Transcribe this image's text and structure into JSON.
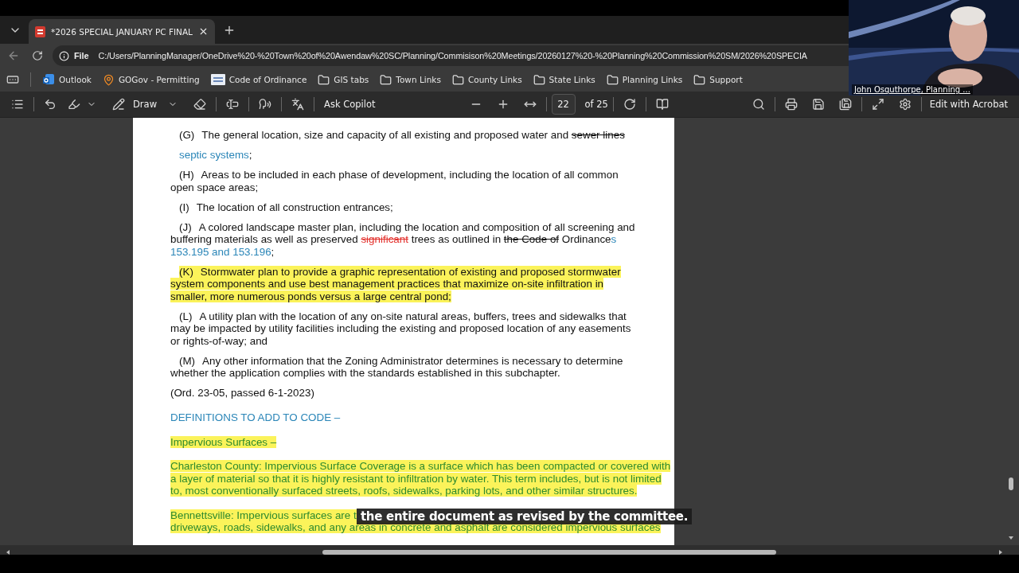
{
  "tabs": [
    {
      "title": "*2026 SPECIAL JANUARY PC FINAL",
      "selected": true
    }
  ],
  "address": {
    "scheme": "File",
    "url": "C:/Users/PlanningManager/OneDrive%20-%20Town%20of%20Awendaw%20SC/Planning/Commisison%20Meetings/20260127%20-%20Planning%20Commission%20SM/2026%20SPECIA"
  },
  "bookmarks": [
    {
      "kind": "outlook",
      "label": "Outlook"
    },
    {
      "kind": "gogov",
      "label": "GOGov - Permitting"
    },
    {
      "kind": "alp",
      "label": "Code of Ordinance"
    },
    {
      "kind": "folder",
      "label": "GIS tabs"
    },
    {
      "kind": "folder",
      "label": "Town Links"
    },
    {
      "kind": "folder",
      "label": "County Links"
    },
    {
      "kind": "folder",
      "label": "State Links"
    },
    {
      "kind": "folder",
      "label": "Planning Links"
    },
    {
      "kind": "folder",
      "label": "Support"
    }
  ],
  "toolbar": {
    "draw_label": "Draw",
    "copilot_label": "Ask Copilot",
    "page": "22",
    "page_total": "of 25",
    "edit_label": "Edit with Acrobat"
  },
  "document": {
    "paragraphs": [
      {
        "kind": "item",
        "label": "(G)",
        "highlighted": false,
        "segments": [
          {
            "kind": "normal",
            "text": "The general location, size and capacity of all existing and proposed water and "
          },
          {
            "kind": "deleted",
            "text": "sewer lines"
          }
        ]
      },
      {
        "kind": "continuation",
        "highlighted": false,
        "segments": [
          {
            "kind": "inserted",
            "text": "septic systems"
          },
          {
            "kind": "normal",
            "text": ";"
          }
        ]
      },
      {
        "kind": "item",
        "label": "(H)",
        "highlighted": false,
        "segments": [
          {
            "kind": "normal",
            "text": "Areas to be included in each phase of development, including the location of all common open space areas;"
          }
        ]
      },
      {
        "kind": "item",
        "label": "(I)",
        "highlighted": false,
        "segments": [
          {
            "kind": "normal",
            "text": "The location of all construction entrances;"
          }
        ]
      },
      {
        "kind": "item",
        "label": "(J)",
        "highlighted": false,
        "segments": [
          {
            "kind": "normal",
            "text": "A colored landscape master plan, including the location and composition of all screening and buffering materials as well as preserved "
          },
          {
            "kind": "deleted_red",
            "text": "significant"
          },
          {
            "kind": "normal",
            "text": " trees as outlined in "
          },
          {
            "kind": "deleted",
            "text": "the Code of"
          },
          {
            "kind": "normal",
            "text": " Ordinance"
          },
          {
            "kind": "inserted",
            "text": "s 153.195 and 153.196"
          },
          {
            "kind": "normal",
            "text": ";"
          }
        ]
      },
      {
        "kind": "item",
        "label": "(K)",
        "highlighted": true,
        "segments": [
          {
            "kind": "normal",
            "text": "Stormwater plan to provide a graphic representation of existing and proposed stormwater system components and use best management practices that maximize on-site infiltration in smaller, more numerous ponds versus a large central pond;"
          }
        ]
      },
      {
        "kind": "item",
        "label": "(L)",
        "highlighted": false,
        "segments": [
          {
            "kind": "normal",
            "text": "A utility plan with the location of any on-site natural areas, buffers, trees and sidewalks that may be impacted by utility facilities including the existing and proposed location of any easements or rights-of-way; and"
          }
        ]
      },
      {
        "kind": "item",
        "label": "(M)",
        "highlighted": false,
        "segments": [
          {
            "kind": "normal",
            "text": "Any other information that the Zoning Administrator determines is necessary to determine whether the application complies with the standards established in this subchapter."
          }
        ]
      },
      {
        "kind": "plain",
        "highlighted": false,
        "segments": [
          {
            "kind": "normal",
            "text": "(Ord. 23-05, passed 6-1-2023)"
          }
        ]
      },
      {
        "kind": "heading",
        "highlighted": false,
        "segments": [
          {
            "kind": "inserted",
            "text": "DEFINITIONS TO ADD TO CODE –"
          }
        ]
      },
      {
        "kind": "definition",
        "highlighted": true,
        "segments": [
          {
            "kind": "normal",
            "text": "Impervious Surfaces –  "
          }
        ]
      },
      {
        "kind": "definition",
        "highlighted": true,
        "segments": [
          {
            "kind": "normal",
            "text": "Charleston County: Impervious Surface Coverage is a surface which has been compacted or covered with a layer of material so that it is highly resistant to infiltration by water. This term includes, but is not limited to, most conventionally surfaced streets, roofs, sidewalks, parking lots, and other similar structures."
          }
        ]
      },
      {
        "kind": "definition",
        "highlighted": true,
        "segments": [
          {
            "kind": "normal",
            "text": "Bennettsville: Impervious surfaces are t"
          },
          {
            "kind": "break"
          },
          {
            "kind": "normal",
            "text": "driveways, roads, sidewalks, and any areas in concrete and asphalt are considered impervious surfaces"
          }
        ]
      }
    ]
  },
  "caption": "the entire document as revised by the committee.",
  "video": {
    "name": "John Osquthorpe, Planning ..."
  }
}
